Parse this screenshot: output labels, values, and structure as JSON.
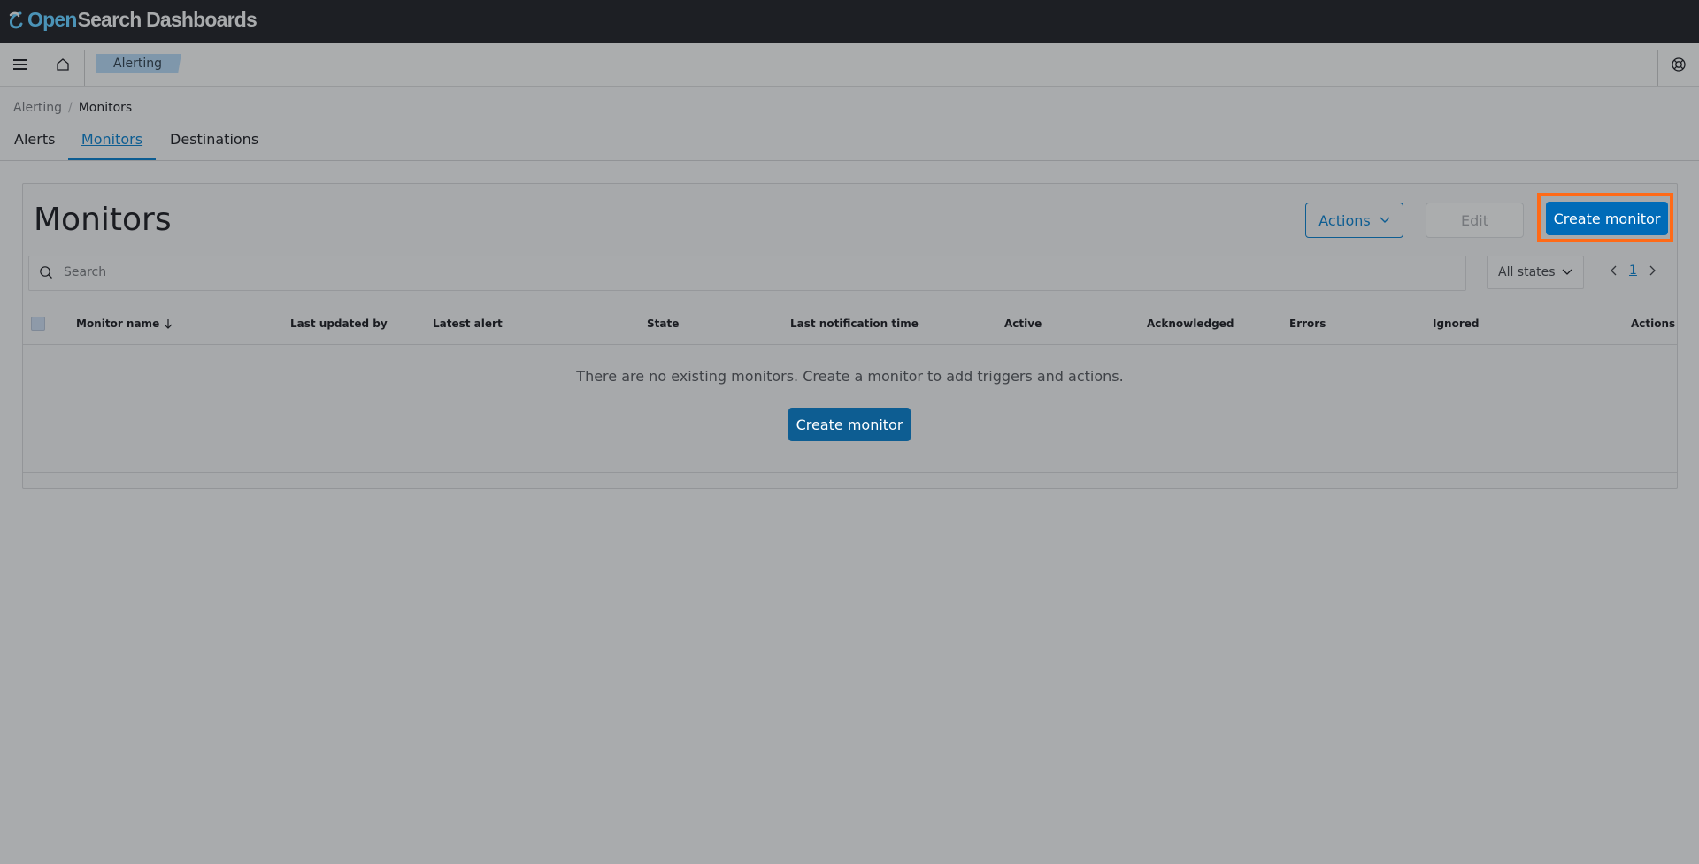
{
  "app": {
    "logo_open": "Open",
    "logo_rest": "Search Dashboards"
  },
  "navbar": {
    "app_crumb": "Alerting",
    "icons": [
      "menu-icon",
      "home-icon",
      "help-icon"
    ]
  },
  "breadcrumb": {
    "root": "Alerting",
    "separator": "/",
    "current": "Monitors"
  },
  "tabs": [
    {
      "label": "Alerts",
      "active": false
    },
    {
      "label": "Monitors",
      "active": true
    },
    {
      "label": "Destinations",
      "active": false
    }
  ],
  "panel": {
    "title": "Monitors",
    "actions_label": "Actions",
    "edit_label": "Edit",
    "create_label": "Create monitor"
  },
  "search": {
    "placeholder": "Search"
  },
  "filter": {
    "selected": "All states"
  },
  "pagination": {
    "current_page": "1"
  },
  "table": {
    "columns": [
      "Monitor name",
      "Last updated by",
      "Latest alert",
      "State",
      "Last notification time",
      "Active",
      "Acknowledged",
      "Errors",
      "Ignored",
      "Actions"
    ],
    "sorted_column": "Monitor name",
    "sort_direction": "descending"
  },
  "empty_state": {
    "message": "There are no existing monitors. Create a monitor to add triggers and actions.",
    "button_label": "Create monitor"
  },
  "colors": {
    "primary": "#006bb8",
    "highlight": "#ff6a17",
    "header": "#1d1f24"
  }
}
